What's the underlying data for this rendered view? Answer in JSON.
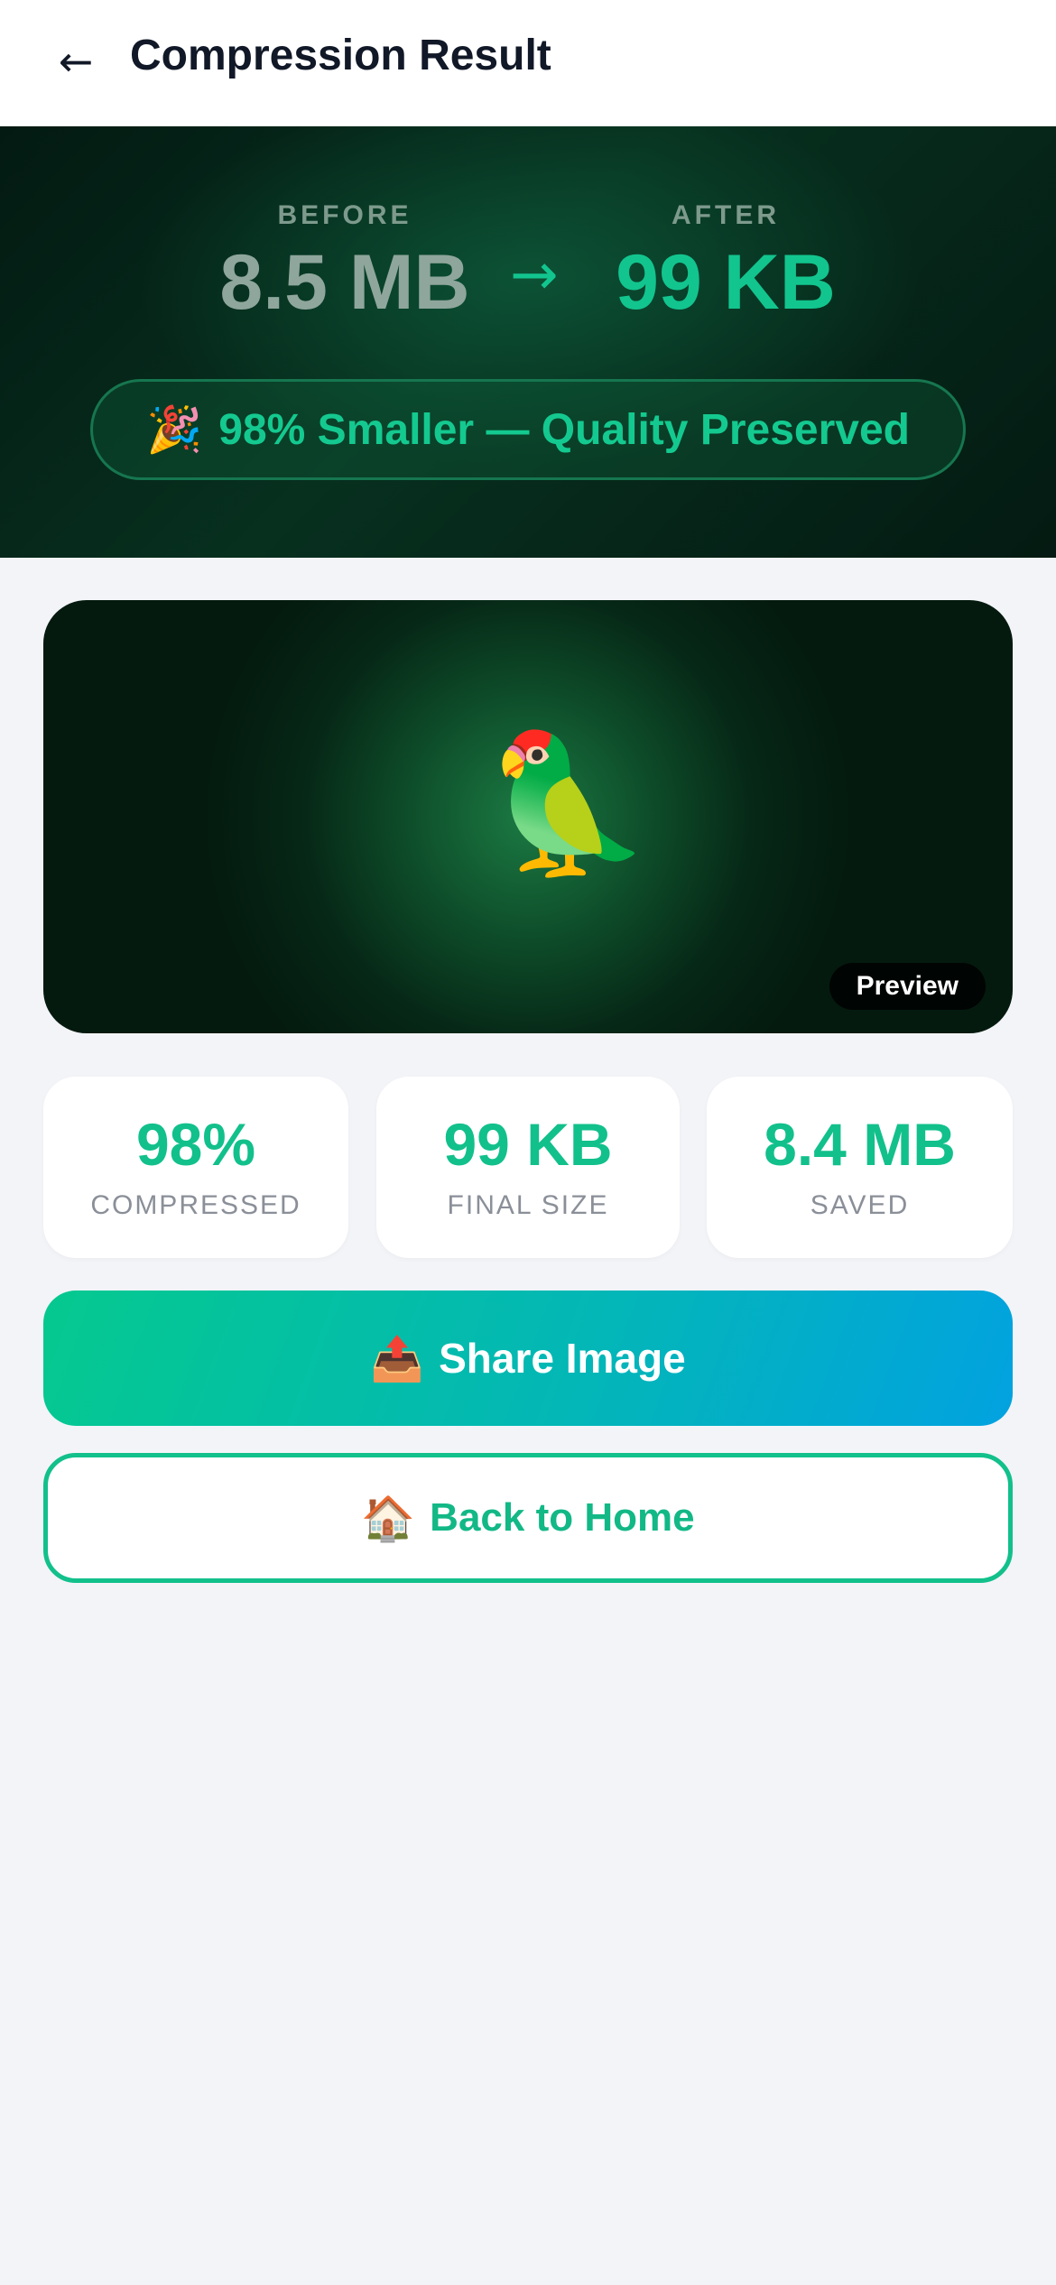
{
  "header": {
    "back_icon": "←",
    "title": "Compression Result"
  },
  "hero": {
    "before_label": "BEFORE",
    "before_value": "8.5 MB",
    "arrow": "→",
    "after_label": "AFTER",
    "after_value": "99 KB",
    "badge_emoji": "🎉",
    "badge_text": "98% Smaller — Quality Preserved"
  },
  "preview": {
    "image_emoji": "🦜",
    "tag": "Preview"
  },
  "stats": [
    {
      "value": "98%",
      "label": "COMPRESSED"
    },
    {
      "value": "99 KB",
      "label": "FINAL SIZE"
    },
    {
      "value": "8.4 MB",
      "label": "SAVED"
    }
  ],
  "actions": {
    "share_emoji": "📤",
    "share_label": "Share Image",
    "home_emoji": "🏠",
    "home_label": "Back to Home"
  },
  "colors": {
    "accent": "#12c08b",
    "hero_bg": "#07301f",
    "page_bg": "#f3f4f8"
  }
}
